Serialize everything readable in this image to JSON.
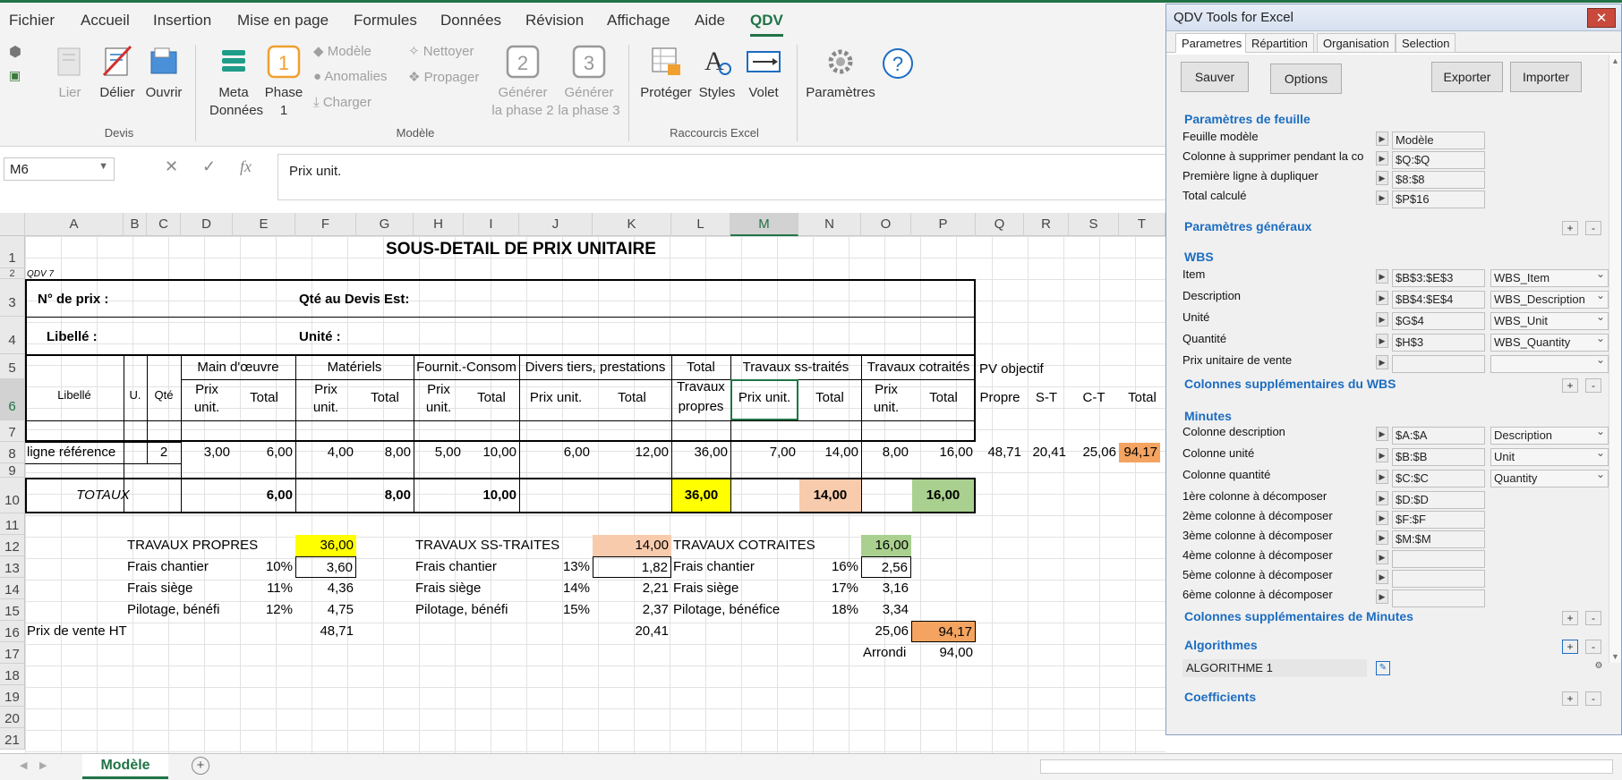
{
  "menu": {
    "items": [
      "Fichier",
      "Accueil",
      "Insertion",
      "Mise en page",
      "Formules",
      "Données",
      "Révision",
      "Affichage",
      "Aide",
      "QDV"
    ]
  },
  "ribbon": {
    "devis": {
      "lier": "Lier",
      "delier": "Délier",
      "ouvrir": "Ouvrir",
      "group": "Devis"
    },
    "modele": {
      "meta1": "Meta",
      "meta2": "Données",
      "phase1": "Phase",
      "phase1n": "1",
      "modele": "Modèle",
      "anomalies": "Anomalies",
      "charger": "Charger",
      "nettoyer": "Nettoyer",
      "propager": "Propager",
      "gen2a": "Générer",
      "gen2b": "la phase 2",
      "gen3a": "Générer",
      "gen3b": "la phase 3",
      "group": "Modèle"
    },
    "raccourcis": {
      "proteger": "Protéger",
      "styles": "Styles",
      "volet": "Volet",
      "group": "Raccourcis Excel"
    },
    "parametres": "Paramètres"
  },
  "formula_bar": {
    "name_box": "M6",
    "fx": "fx",
    "value": "Prix unit."
  },
  "columns": [
    "A",
    "B",
    "C",
    "D",
    "E",
    "F",
    "G",
    "H",
    "I",
    "J",
    "K",
    "L",
    "M",
    "N",
    "O",
    "P",
    "Q",
    "R",
    "S",
    "T"
  ],
  "rows": [
    "1",
    "2",
    "3",
    "4",
    "5",
    "6",
    "7",
    "8",
    "9",
    "10",
    "11",
    "12",
    "13",
    "14",
    "15",
    "16",
    "17",
    "18",
    "19",
    "20",
    "21"
  ],
  "sheet": {
    "title": "SOUS-DETAIL DE PRIX UNITAIRE",
    "qdv7": "QDV 7",
    "no_prix": "N° de prix :",
    "qte_devis": "Qté au Devis Est:",
    "libelle": "Libellé :",
    "unite": "Unité :",
    "h_libelle": "Libellé",
    "h_u": "U.",
    "h_qte": "Qté",
    "h_main": "Main d'œuvre",
    "h_materiels": "Matériels",
    "h_fournit": "Fournit.-Consom",
    "h_divers": "Divers tiers, prestations",
    "h_total1": "Total",
    "h_total2": "Travaux",
    "h_total3": "propres",
    "h_ss": "Travaux ss-traités",
    "h_cot": "Travaux cotraités",
    "h_pv": "PV objectif",
    "prix": "Prix",
    "unit": "unit.",
    "prix_unit": "Prix unit.",
    "total": "Total",
    "propre": "Propre",
    "st": "S-T",
    "ct": "C-T",
    "row8": {
      "label": "ligne référence",
      "qte": "2",
      "d": "3,00",
      "e": "6,00",
      "f": "4,00",
      "g": "8,00",
      "h": "5,00",
      "i": "10,00",
      "j": "6,00",
      "k": "12,00",
      "l": "36,00",
      "m": "7,00",
      "n": "14,00",
      "o": "8,00",
      "p": "16,00",
      "q": "48,71",
      "r": "20,41",
      "s": "25,06",
      "t": "94,17"
    },
    "totaux": {
      "label": "TOTAUX",
      "e": "6,00",
      "g": "8,00",
      "i": "10,00",
      "l": "36,00",
      "n": "14,00",
      "p": "16,00"
    },
    "summary": {
      "tp": "TRAVAUX PROPRES",
      "tp_v": "36,00",
      "tst": "TRAVAUX SS-TRAITES",
      "tst_v": "14,00",
      "tc": "TRAVAUX COTRAITES",
      "tc_v": "16,00",
      "fc": "Frais chantier",
      "fs": "Frais siège",
      "pb": "Pilotage, bénéfi",
      "pb_full": "Pilotage, bénéfice",
      "a_fc_p": "10%",
      "a_fc_v": "3,60",
      "a_fs_p": "11%",
      "a_fs_v": "4,36",
      "a_pb_p": "12%",
      "a_pb_v": "4,75",
      "b_fc_p": "13%",
      "b_fc_v": "1,82",
      "b_fs_p": "14%",
      "b_fs_v": "2,21",
      "b_pb_p": "15%",
      "b_pb_v": "2,37",
      "c_fc_p": "16%",
      "c_fc_v": "2,56",
      "c_fs_p": "17%",
      "c_fs_v": "3,16",
      "c_pb_p": "18%",
      "c_pb_v": "3,34",
      "pv_label": "Prix de vente HT",
      "pv_a": "48,71",
      "pv_b": "20,41",
      "pv_c": "25,06",
      "pv_total": "94,17",
      "arrondi": "Arrondi",
      "arrondi_v": "94,00"
    }
  },
  "sheet_tab": {
    "name": "Modèle",
    "add": "+"
  },
  "qdv": {
    "title": "QDV Tools for Excel",
    "close": "✕",
    "tabs": [
      "Parametres",
      "Répartition",
      "Organisation",
      "Selection"
    ],
    "buttons": {
      "sauver": "Sauver",
      "options": "Options",
      "exporter": "Exporter",
      "importer": "Importer"
    },
    "sections": {
      "feuille": "Paramètres de feuille",
      "generaux": "Paramètres généraux",
      "wbs": "WBS",
      "col_wbs": "Colonnes supplémentaires du WBS",
      "minutes": "Minutes",
      "col_minutes": "Colonnes supplémentaires de Minutes",
      "algorithmes": "Algorithmes",
      "coefficients": "Coefficients"
    },
    "feuille": [
      {
        "label": "Feuille modèle",
        "value": "Modèle"
      },
      {
        "label": "Colonne à supprimer pendant la co",
        "value": "$Q:$Q"
      },
      {
        "label": "Première ligne à dupliquer",
        "value": "$8:$8"
      },
      {
        "label": "Total calculé",
        "value": "$P$16"
      }
    ],
    "wbs": [
      {
        "label": "Item",
        "value": "$B$3:$E$3",
        "select": "WBS_Item"
      },
      {
        "label": "Description",
        "value": "$B$4:$E$4",
        "select": "WBS_Description"
      },
      {
        "label": "Unité",
        "value": "$G$4",
        "select": "WBS_Unit"
      },
      {
        "label": "Quantité",
        "value": "$H$3",
        "select": "WBS_Quantity"
      },
      {
        "label": "Prix unitaire de vente",
        "value": "",
        "select": ""
      }
    ],
    "minutes": [
      {
        "label": "Colonne description",
        "value": "$A:$A",
        "select": "Description"
      },
      {
        "label": "Colonne unité",
        "value": "$B:$B",
        "select": "Unit"
      },
      {
        "label": "Colonne quantité",
        "value": "$C:$C",
        "select": "Quantity"
      },
      {
        "label": "1ère colonne à décomposer",
        "value": "$D:$D"
      },
      {
        "label": "2ème colonne à décomposer",
        "value": "$F:$F"
      },
      {
        "label": "3ème colonne à décomposer",
        "value": "$M:$M"
      },
      {
        "label": "4ème colonne à décomposer",
        "value": ""
      },
      {
        "label": "5ème colonne à décomposer",
        "value": ""
      },
      {
        "label": "6ème colonne à décomposer",
        "value": ""
      }
    ],
    "algorithme": "ALGORITHME 1",
    "plus": "+",
    "minus": "-"
  },
  "colors": {
    "excel_green": "#217346",
    "yellow": "#ffff00",
    "salmon": "#f8cbad",
    "green": "#a9d08e",
    "orange": "#f4a460",
    "qdv_blue": "#1c6dc1"
  }
}
